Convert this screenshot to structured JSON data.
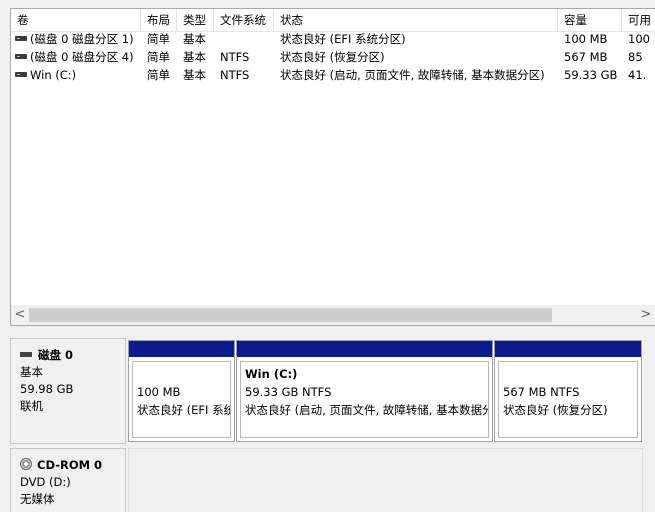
{
  "columns": [
    "卷",
    "布局",
    "类型",
    "文件系统",
    "状态",
    "容量",
    "可用"
  ],
  "volumes": [
    {
      "name": "(磁盘 0 磁盘分区 1)",
      "layout": "简单",
      "type": "基本",
      "fs": "",
      "status": "状态良好 (EFI 系统分区)",
      "capacity": "100 MB",
      "free": "100"
    },
    {
      "name": "(磁盘 0 磁盘分区 4)",
      "layout": "简单",
      "type": "基本",
      "fs": "NTFS",
      "status": "状态良好 (恢复分区)",
      "capacity": "567 MB",
      "free": "85"
    },
    {
      "name": "Win (C:)",
      "layout": "简单",
      "type": "基本",
      "fs": "NTFS",
      "status": "状态良好 (启动, 页面文件, 故障转储, 基本数据分区)",
      "capacity": "59.33 GB",
      "free": "41."
    }
  ],
  "scroll": {
    "left": "<",
    "right": ">"
  },
  "disk0": {
    "title": "磁盘 0",
    "type": "基本",
    "size": "59.98 GB",
    "status": "联机",
    "partitions": [
      {
        "name": "",
        "size": "100 MB",
        "status": "状态良好 (EFI 系统分区)"
      },
      {
        "name": "Win  (C:)",
        "size": "59.33 GB NTFS",
        "status": "状态良好 (启动, 页面文件, 故障转储, 基本数据分区)"
      },
      {
        "name": "",
        "size": "567 MB NTFS",
        "status": "状态良好 (恢复分区)"
      }
    ]
  },
  "cdrom": {
    "title": "CD-ROM 0",
    "drive": "DVD (D:)",
    "status": "无媒体"
  },
  "icons": {
    "volume": "disk-volume-icon",
    "disk": "hard-disk-icon",
    "cdrom": "cd-rom-icon"
  }
}
